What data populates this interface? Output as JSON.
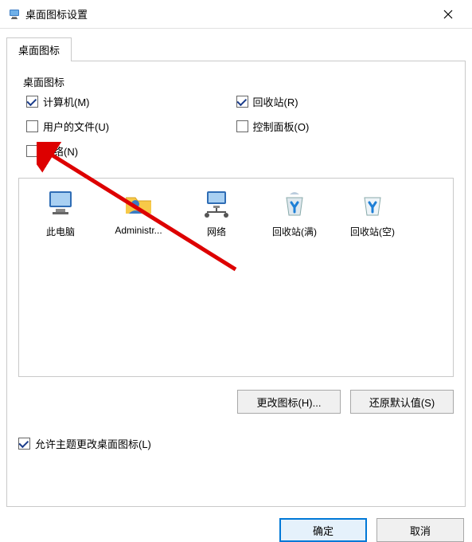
{
  "window": {
    "title": "桌面图标设置"
  },
  "tabs": {
    "tab1": "桌面图标"
  },
  "group": {
    "label": "桌面图标",
    "computer": "计算机(M)",
    "recycle": "回收站(R)",
    "userfiles": "用户的文件(U)",
    "controlpanel": "控制面板(O)",
    "network": "网络(N)"
  },
  "icons": {
    "thispc": "此电脑",
    "admin": "Administr...",
    "network": "网络",
    "recyclefull": "回收站(满)",
    "recycleempty": "回收站(空)"
  },
  "buttons": {
    "changeicon": "更改图标(H)...",
    "restoredefault": "还原默认值(S)",
    "ok": "确定",
    "cancel": "取消"
  },
  "allowtheme": "允许主题更改桌面图标(L)"
}
